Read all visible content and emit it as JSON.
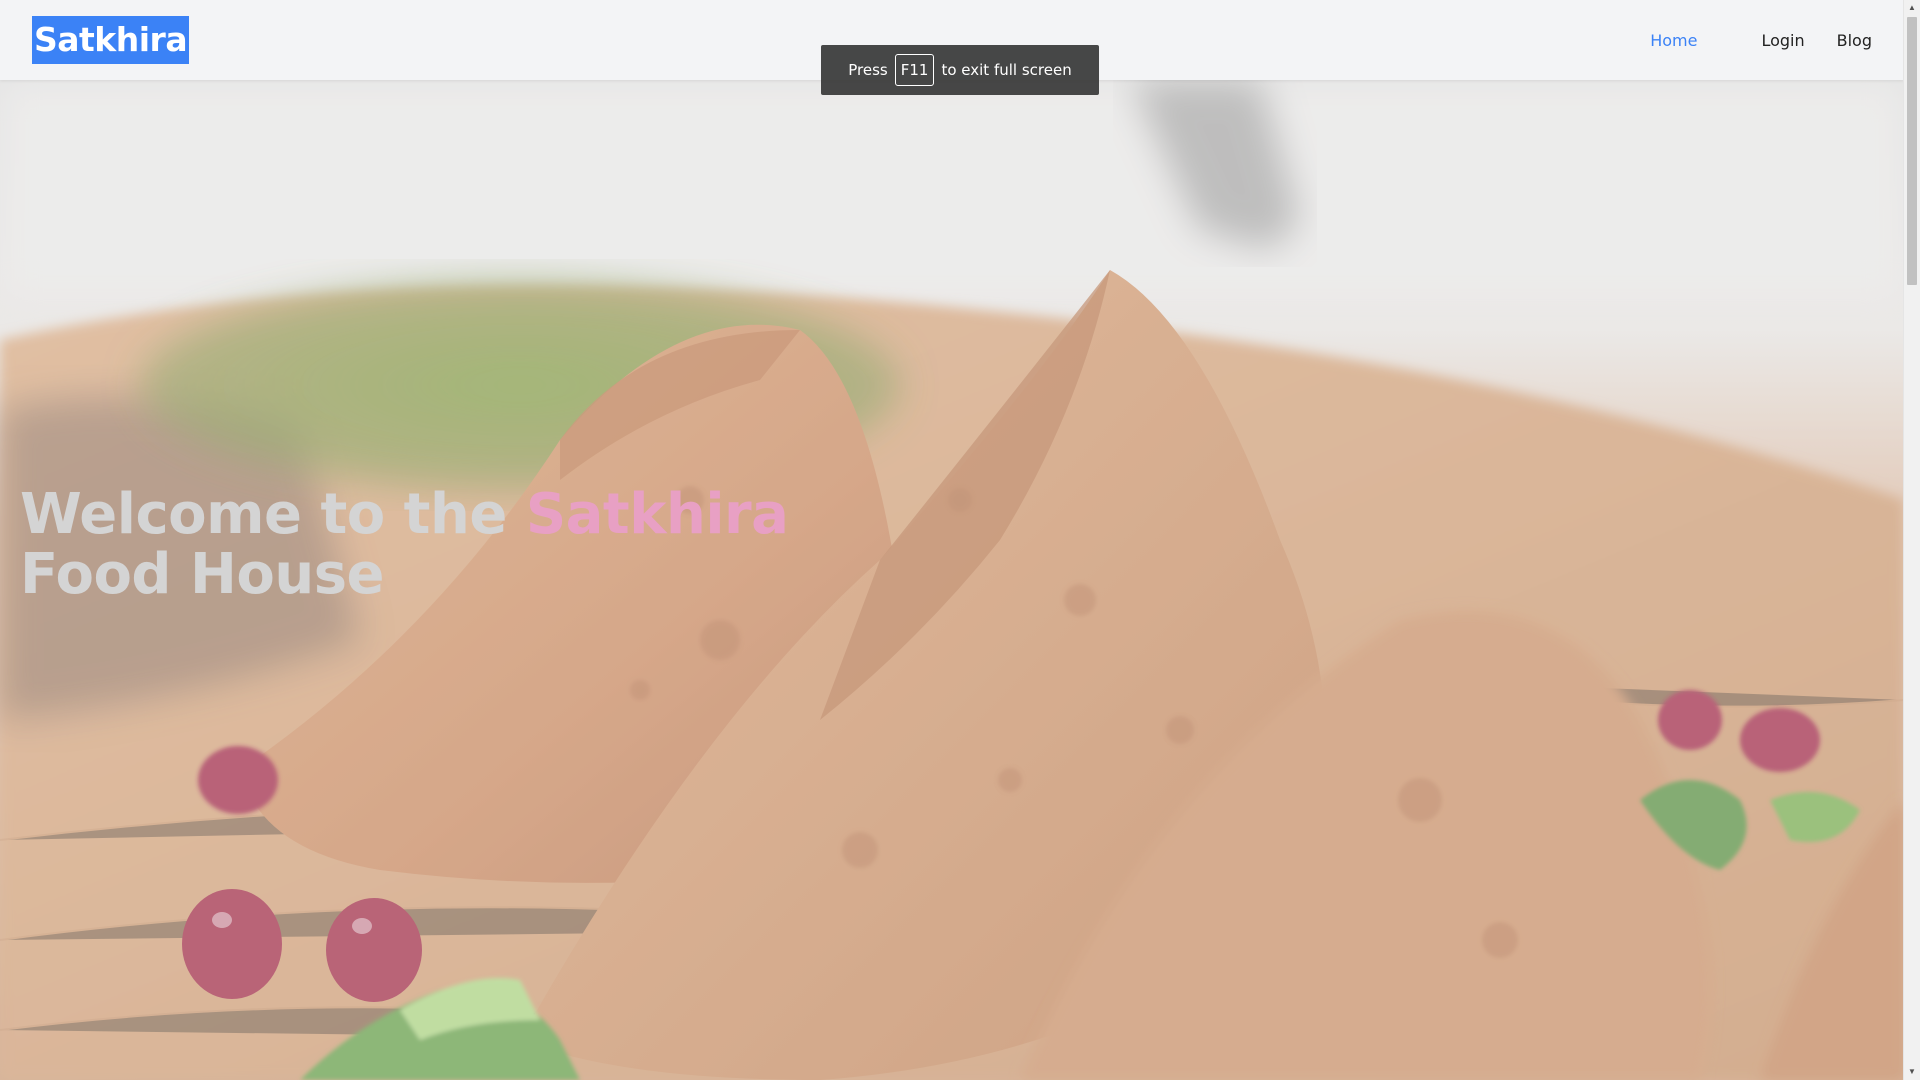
{
  "navbar": {
    "logo_text": "Satkhira",
    "links": [
      {
        "label": "Home",
        "active": true
      },
      {
        "label": "Login",
        "active": false
      },
      {
        "label": "Blog",
        "active": false
      }
    ]
  },
  "fullscreen_notice": {
    "prefix": "Press",
    "key": "F11",
    "suffix": "to exit full screen"
  },
  "hero": {
    "title_part1": "Welcome to the",
    "title_accent": "Satkhira",
    "title_part2": "Food House",
    "background_image": "samosas-on-wooden-board"
  },
  "colors": {
    "accent_blue": "#3b82f6",
    "title_gray": "#d4d4d4",
    "title_pink": "#e8a0c4"
  },
  "icons": {
    "scroll_up": "▲",
    "scroll_down": "▼"
  }
}
